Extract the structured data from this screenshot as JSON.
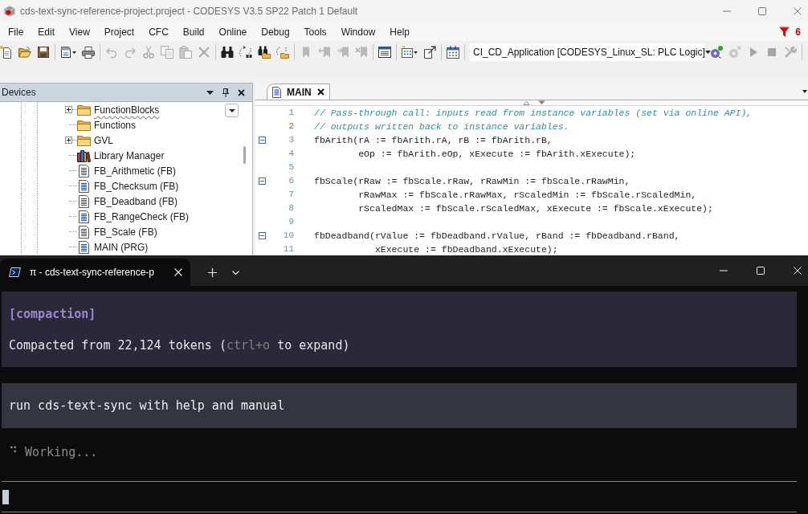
{
  "window": {
    "title": "cds-text-sync-reference-project.project - CODESYS V3.5 SP22 Patch 1 Default"
  },
  "menu": [
    "File",
    "Edit",
    "View",
    "Project",
    "CFC",
    "Build",
    "Online",
    "Debug",
    "Tools",
    "Window",
    "Help"
  ],
  "messages": {
    "count": "6"
  },
  "toolbar": {
    "buttons": [
      {
        "disabled": false
      },
      {
        "disabled": false
      },
      {
        "disabled": false
      },
      {
        "disabled": false
      },
      {
        "disabled": false
      },
      {
        "disabled": true
      },
      {
        "disabled": true
      },
      {
        "disabled": true
      },
      {
        "disabled": true
      },
      {
        "disabled": true
      },
      {
        "disabled": true
      },
      {
        "disabled": false
      },
      {
        "disabled": false
      },
      {
        "disabled": false
      },
      {
        "disabled": false
      },
      {
        "disabled": true
      },
      {
        "disabled": true
      },
      {
        "disabled": true
      },
      {
        "disabled": true
      },
      {
        "disabled": false
      },
      {
        "disabled": false
      },
      {
        "disabled": false
      },
      {
        "disabled": false
      },
      {
        "disabled": false
      },
      {
        "disabled": true
      },
      {
        "disabled": true
      },
      {
        "disabled": true
      },
      {
        "disabled": true
      }
    ],
    "target": "CI_CD_Application [CODESYS_Linux_SL: PLC Logic]"
  },
  "devices_panel": {
    "title": "Devices",
    "items": [
      {
        "label": "FunctionBlocks",
        "kind": "folder",
        "collapsed": true,
        "focused": true
      },
      {
        "label": "Functions",
        "kind": "folder",
        "collapsed": false,
        "focused": false
      },
      {
        "label": "GVL",
        "kind": "folder",
        "collapsed": true,
        "focused": false
      },
      {
        "label": "Library Manager",
        "kind": "library",
        "collapsed": false,
        "focused": false
      },
      {
        "label": "FB_Arithmetic (FB)",
        "kind": "pou",
        "collapsed": false,
        "focused": false
      },
      {
        "label": "FB_Checksum (FB)",
        "kind": "pou",
        "collapsed": false,
        "focused": false
      },
      {
        "label": "FB_Deadband (FB)",
        "kind": "pou",
        "collapsed": false,
        "focused": false
      },
      {
        "label": "FB_RangeCheck (FB)",
        "kind": "pou",
        "collapsed": false,
        "focused": false
      },
      {
        "label": "FB_Scale (FB)",
        "kind": "pou",
        "collapsed": false,
        "focused": false
      },
      {
        "label": "MAIN (PRG)",
        "kind": "pou",
        "collapsed": false,
        "focused": false
      }
    ]
  },
  "editor": {
    "tabs": [
      {
        "label": "MAIN",
        "selected": true
      }
    ],
    "lines": [
      {
        "number": "1",
        "kind": "comment",
        "text": "// Pass-through call: inputs read from instance variables (set via online API),",
        "fold": false,
        "current": false
      },
      {
        "number": "2",
        "kind": "comment",
        "text": "// outputs written back to instance variables.",
        "fold": false,
        "current": true
      },
      {
        "number": "3",
        "kind": "code",
        "text": "fbArith(rA := fbArith.rA, rB := fbArith.rB,",
        "fold": true,
        "current": false
      },
      {
        "number": "4",
        "kind": "code",
        "text": "        eOp := fbArith.eOp, xExecute := fbArith.xExecute);",
        "fold": false,
        "current": false
      },
      {
        "number": "5",
        "kind": "code",
        "fold": false,
        "current": false
      },
      {
        "number": "6",
        "kind": "code",
        "text": "fbScale(rRaw := fbScale.rRaw, rRawMin := fbScale.rRawMin,",
        "fold": true,
        "current": false
      },
      {
        "number": "7",
        "kind": "code",
        "text": "        rRawMax := fbScale.rRawMax, rScaledMin := fbScale.rScaledMin,",
        "fold": false,
        "current": false
      },
      {
        "number": "8",
        "kind": "code",
        "text": "        rScaledMax := fbScale.rScaledMax, xExecute := fbScale.xExecute);",
        "fold": false,
        "current": false
      },
      {
        "number": "9",
        "kind": "code",
        "fold": false,
        "current": false
      },
      {
        "number": "10",
        "kind": "code",
        "text": "fbDeadband(rValue := fbDeadband.rValue, rBand := fbDeadband.rBand,",
        "fold": true,
        "current": false
      },
      {
        "number": "11",
        "kind": "code",
        "text": "           xExecute := fbDeadband.xExecute);",
        "fold": false,
        "current": false
      }
    ]
  },
  "terminal": {
    "tabs": [
      {
        "title": "π - cds-text-sync-reference-p",
        "selected": true
      }
    ],
    "blocks": [
      {
        "kind": "notice",
        "label": "[compaction]",
        "summary": {
          "before": "Compacted from 22,124 tokens (",
          "key": "ctrl+o",
          "after": " to expand)"
        }
      },
      {
        "kind": "prompt",
        "text": "run cds-text-sync with help and manual"
      },
      {
        "kind": "status",
        "spinner": "⠙",
        "text": "Working..."
      }
    ]
  }
}
